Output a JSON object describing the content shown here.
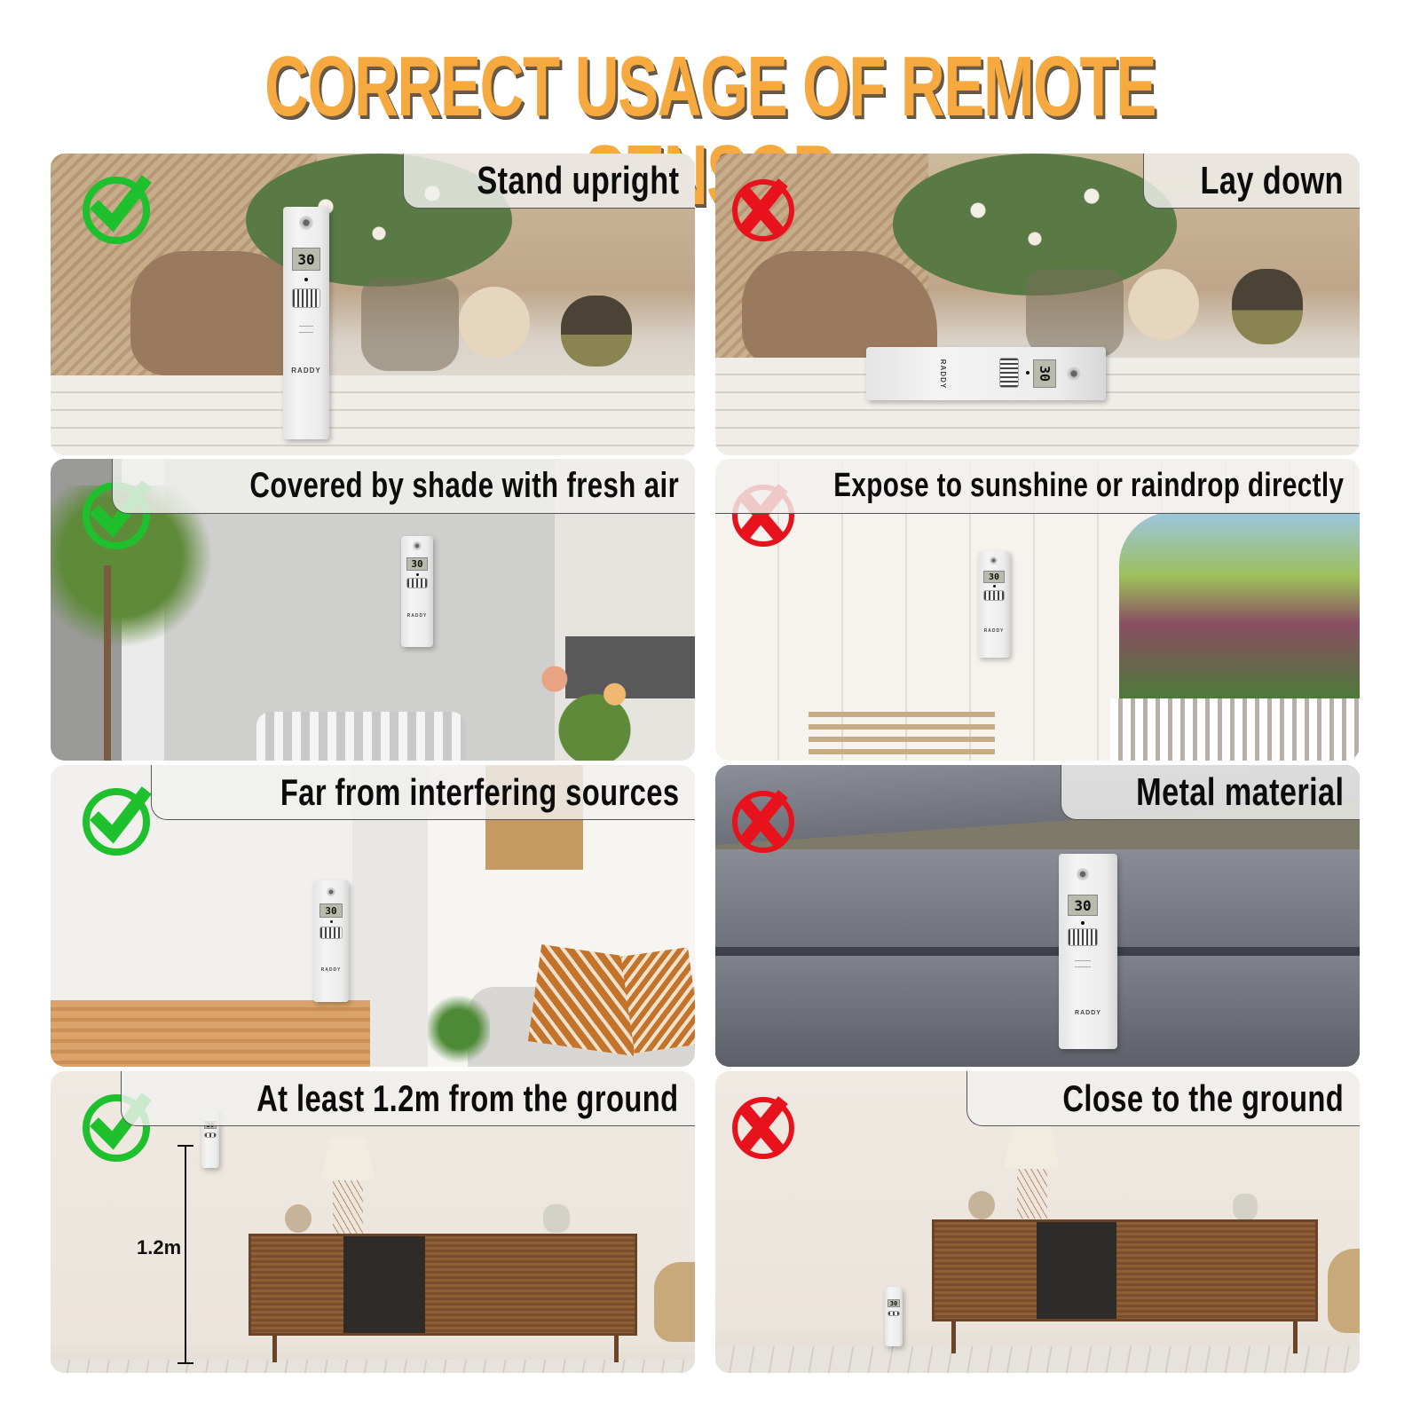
{
  "title": "CORRECT USAGE OF REMOTE SENSOR",
  "colors": {
    "title": "#f5a93f",
    "correct": "#1fc02e",
    "incorrect": "#e8121c"
  },
  "sensor": {
    "brand": "RADDY",
    "display": "30"
  },
  "panels": [
    {
      "label": "Stand upright",
      "status": "correct",
      "icon": "check-circle-icon"
    },
    {
      "label": "Lay down",
      "status": "incorrect",
      "icon": "x-circle-icon"
    },
    {
      "label": "Covered by shade with fresh air",
      "status": "correct",
      "icon": "check-circle-icon"
    },
    {
      "label": "Expose to sunshine or raindrop directly",
      "status": "incorrect",
      "icon": "x-circle-icon"
    },
    {
      "label": "Far from interfering sources",
      "status": "correct",
      "icon": "check-circle-icon"
    },
    {
      "label": "Metal material",
      "status": "incorrect",
      "icon": "x-circle-icon"
    },
    {
      "label": "At least 1.2m from the ground",
      "status": "correct",
      "icon": "check-circle-icon",
      "measure": "1.2m"
    },
    {
      "label": "Close to the ground",
      "status": "incorrect",
      "icon": "x-circle-icon"
    }
  ]
}
